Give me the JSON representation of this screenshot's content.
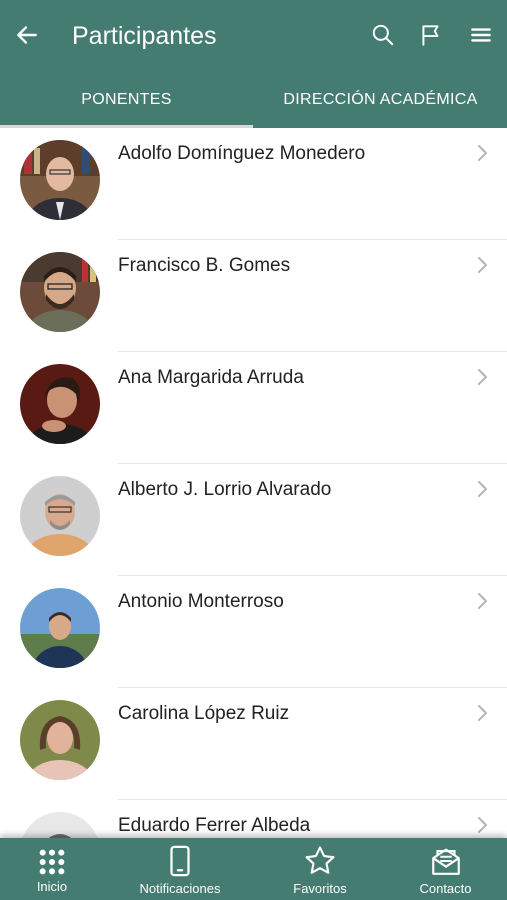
{
  "header": {
    "title": "Participantes",
    "back_icon": "arrow-left-icon",
    "actions": [
      "search-icon",
      "flag-icon",
      "menu-icon"
    ]
  },
  "tabs": [
    {
      "label": "PONENTES",
      "active": true
    },
    {
      "label": "DIRECCIÓN ACADÉMICA",
      "active": false
    }
  ],
  "speakers": [
    {
      "name": "Adolfo Domínguez Monedero"
    },
    {
      "name": "Francisco B. Gomes"
    },
    {
      "name": "Ana Margarida Arruda"
    },
    {
      "name": "Alberto J. Lorrio Alvarado"
    },
    {
      "name": "Antonio Monterroso"
    },
    {
      "name": "Carolina López Ruiz"
    },
    {
      "name": "Eduardo Ferrer Albeda"
    }
  ],
  "bottom_nav": [
    {
      "label": "Inicio",
      "icon": "grid-icon"
    },
    {
      "label": "Notificaciones",
      "icon": "phone-icon"
    },
    {
      "label": "Favoritos",
      "icon": "star-icon"
    },
    {
      "label": "Contacto",
      "icon": "envelope-icon"
    }
  ],
  "colors": {
    "primary": "#457c71",
    "tab_indicator": "#d9d9d9",
    "text": "#222222"
  }
}
